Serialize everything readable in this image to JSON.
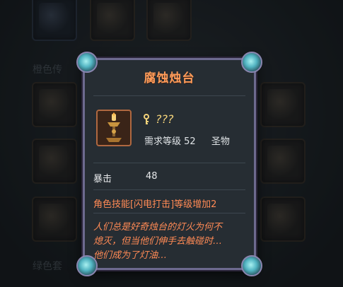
{
  "background": {
    "section_labels": [
      "橙色传",
      "绿色套"
    ]
  },
  "popup": {
    "title": "腐蚀烛台",
    "name_unknown": "???",
    "required_level_label": "需求等级",
    "required_level_value": "52",
    "item_type": "圣物",
    "stat_label": "暴击",
    "stat_value": "48",
    "skill_text": "角色技能[闪电打击]等级增加2",
    "lore_lines": [
      "人们总是好奇烛台的灯火为何不",
      "熄灭，但当他们伸手去触碰时…",
      "他们成为了灯油…"
    ],
    "colors": {
      "title": "#ff9c5a",
      "unknown_name": "#f2d27a",
      "skill": "#ff8a55",
      "frame": "#6d6a8f",
      "gem": "#52b4c2"
    },
    "icons": [
      "candlestick-icon",
      "key-icon"
    ]
  }
}
